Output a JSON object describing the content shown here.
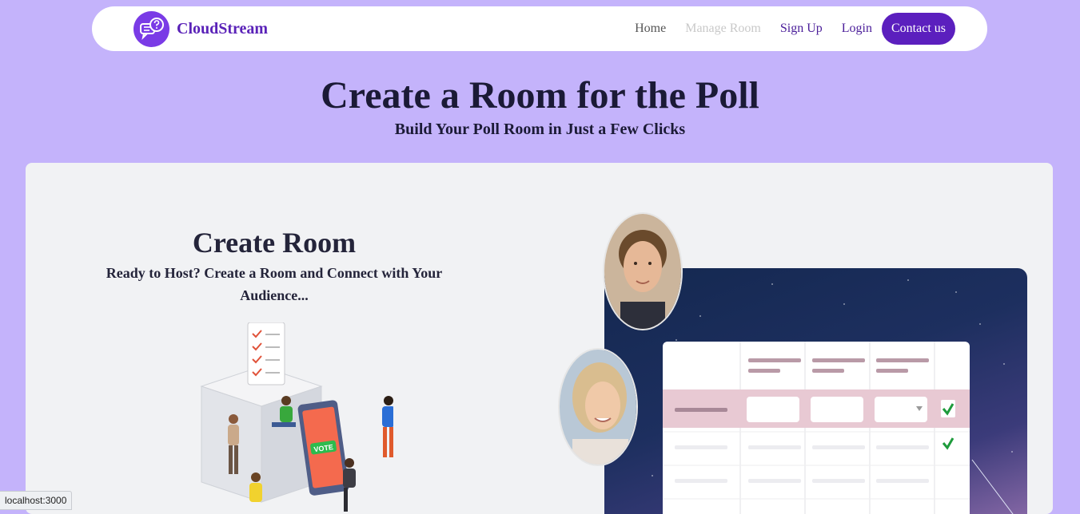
{
  "navbar": {
    "brand": "CloudStream",
    "links": [
      "Home",
      "Manage Room",
      "Sign Up",
      "Login"
    ],
    "contact_label": "Contact us",
    "logo_icon": "chat-question-icon"
  },
  "hero": {
    "title": "Create a Room for the Poll",
    "subtitle": "Build Your Poll Room in Just a Few Clicks"
  },
  "card": {
    "title": "Create Room",
    "description": "Ready to Host? Create a Room and Connect with Your Audience...",
    "illustration_label": "VOTE"
  },
  "status_bar": {
    "url": "localhost:3000"
  },
  "colors": {
    "background": "#c4b3fb",
    "brand": "#5a22b8",
    "contact_button": "#5b1fbe",
    "card": "#f1f2f4"
  }
}
